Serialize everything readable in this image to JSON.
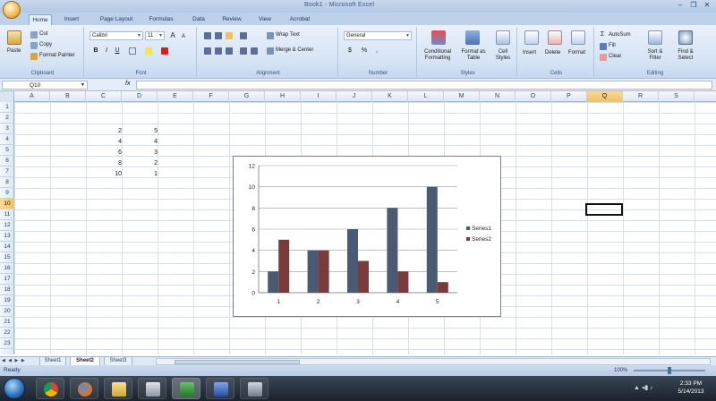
{
  "app": {
    "title": "Book1 - Microsoft Excel",
    "window_buttons": [
      "–",
      "❐",
      "✕"
    ]
  },
  "tabs": [
    {
      "label": "Home",
      "active": true
    },
    {
      "label": "Insert"
    },
    {
      "label": "Page Layout"
    },
    {
      "label": "Formulas"
    },
    {
      "label": "Data"
    },
    {
      "label": "Review"
    },
    {
      "label": "View"
    },
    {
      "label": "Acrobat"
    }
  ],
  "ribbon": {
    "clipboard": {
      "name": "Clipboard",
      "paste": "Paste",
      "cut": "Cut",
      "copy": "Copy",
      "format_painter": "Format Painter"
    },
    "font": {
      "name": "Font",
      "font_name": "Calibri",
      "font_size": "11",
      "bold": "B",
      "italic": "I",
      "underline": "U",
      "grow": "A",
      "shrink": "A"
    },
    "alignment": {
      "name": "Alignment",
      "wrap": "Wrap Text",
      "merge": "Merge & Center"
    },
    "number": {
      "name": "Number",
      "format": "General",
      "currency": "$",
      "percent": "%",
      "comma": ","
    },
    "styles": {
      "name": "Styles",
      "conditional": "Conditional Formatting",
      "format_table": "Format as Table",
      "cell_styles": "Cell Styles"
    },
    "cells": {
      "name": "Cells",
      "insert": "Insert",
      "delete": "Delete",
      "format": "Format"
    },
    "editing": {
      "name": "Editing",
      "autosum": "AutoSum",
      "fill": "Fill",
      "clear": "Clear",
      "sort": "Sort & Filter",
      "find": "Find & Select"
    }
  },
  "formula_bar": {
    "name_box": "Q10",
    "fx": "fx",
    "value": ""
  },
  "columns": [
    "A",
    "B",
    "C",
    "D",
    "E",
    "F",
    "G",
    "H",
    "I",
    "J",
    "K",
    "L",
    "M",
    "N",
    "O",
    "P",
    "Q",
    "R",
    "S"
  ],
  "rows": [
    "1",
    "2",
    "3",
    "4",
    "5",
    "6",
    "7",
    "8",
    "9",
    "10",
    "11",
    "12",
    "13",
    "14",
    "15",
    "16",
    "17",
    "18",
    "19",
    "20",
    "21",
    "22",
    "23"
  ],
  "selected": {
    "column": "Q",
    "row": "10"
  },
  "cells": {
    "C": [
      "2",
      "4",
      "6",
      "8",
      "10"
    ],
    "D": [
      "5",
      "4",
      "3",
      "2",
      "1"
    ]
  },
  "chart_data": {
    "type": "bar",
    "categories": [
      "1",
      "2",
      "3",
      "4",
      "5"
    ],
    "series": [
      {
        "name": "Series1",
        "values": [
          2,
          4,
          6,
          8,
          10
        ],
        "color": "#4a5a73"
      },
      {
        "name": "Series2",
        "values": [
          5,
          4,
          3,
          2,
          1
        ],
        "color": "#7a3b3d"
      }
    ],
    "yticks": [
      "0",
      "2",
      "4",
      "6",
      "8",
      "10",
      "12"
    ],
    "ylim": [
      0,
      12
    ],
    "grid": true,
    "legend": "right"
  },
  "sheets": [
    {
      "label": "Sheet1"
    },
    {
      "label": "Sheet2",
      "active": true
    },
    {
      "label": "Sheet3"
    }
  ],
  "status": {
    "ready": "Ready",
    "zoom": "100%"
  },
  "taskbar": {
    "clock_time": "2:33 PM",
    "clock_date": "5/14/2013"
  }
}
